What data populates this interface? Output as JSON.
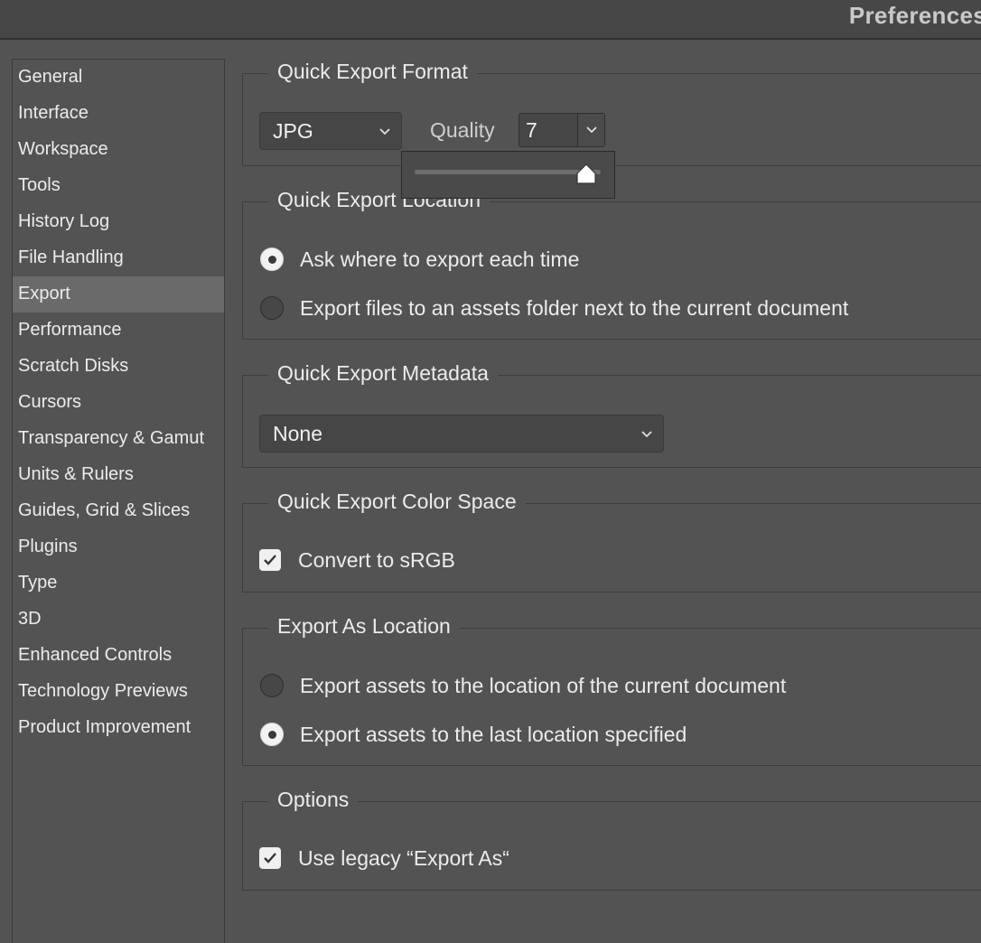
{
  "window": {
    "title": "Preferences"
  },
  "sidebar": {
    "items": [
      {
        "label": "General"
      },
      {
        "label": "Interface"
      },
      {
        "label": "Workspace"
      },
      {
        "label": "Tools"
      },
      {
        "label": "History Log"
      },
      {
        "label": "File Handling"
      },
      {
        "label": "Export",
        "selected": true
      },
      {
        "label": "Performance"
      },
      {
        "label": "Scratch Disks"
      },
      {
        "label": "Cursors"
      },
      {
        "label": "Transparency & Gamut"
      },
      {
        "label": "Units & Rulers"
      },
      {
        "label": "Guides, Grid & Slices"
      },
      {
        "label": "Plugins"
      },
      {
        "label": "Type"
      },
      {
        "label": "3D"
      },
      {
        "label": "Enhanced Controls"
      },
      {
        "label": "Technology Previews"
      },
      {
        "label": "Product Improvement"
      }
    ]
  },
  "quick_export_format": {
    "legend": "Quick Export Format",
    "format_value": "JPG",
    "quality_label": "Quality",
    "quality_value": "7",
    "slider_level": 0.92
  },
  "quick_export_location": {
    "legend": "Quick Export Location",
    "options": [
      {
        "label": "Ask where to export each time",
        "selected": true
      },
      {
        "label": "Export files to an assets folder next to the current document",
        "selected": false
      }
    ]
  },
  "quick_export_metadata": {
    "legend": "Quick Export Metadata",
    "value": "None"
  },
  "quick_export_color_space": {
    "legend": "Quick Export Color Space",
    "convert_label": "Convert to sRGB",
    "checked": true
  },
  "export_as_location": {
    "legend": "Export As Location",
    "options": [
      {
        "label": "Export assets to the location of the current document",
        "selected": false
      },
      {
        "label": "Export assets to the last location specified",
        "selected": true
      }
    ]
  },
  "options": {
    "legend": "Options",
    "legacy_label": "Use legacy “Export As“",
    "checked": true
  },
  "colors": {
    "background": "#535353",
    "selected_item": "#6a6a6a",
    "text": "#ececec"
  }
}
